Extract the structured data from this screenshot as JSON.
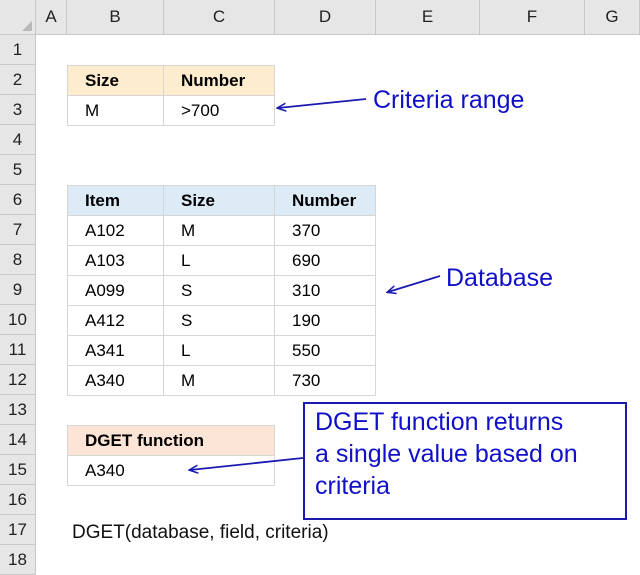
{
  "columns": [
    "A",
    "B",
    "C",
    "D",
    "E",
    "F",
    "G"
  ],
  "rows": [
    "1",
    "2",
    "3",
    "4",
    "5",
    "6",
    "7",
    "8",
    "9",
    "10",
    "11",
    "12",
    "13",
    "14",
    "15",
    "16",
    "17",
    "18"
  ],
  "criteria": {
    "headers": [
      "Size",
      "Number"
    ],
    "values": [
      "M",
      ">700"
    ],
    "label": "Criteria range"
  },
  "database": {
    "headers": [
      "Item",
      "Size",
      "Number"
    ],
    "rows": [
      [
        "A102",
        "M",
        "370"
      ],
      [
        "A103",
        "L",
        "690"
      ],
      [
        "A099",
        "S",
        "310"
      ],
      [
        "A412",
        "S",
        "190"
      ],
      [
        "A341",
        "L",
        "550"
      ],
      [
        "A340",
        "M",
        "730"
      ]
    ],
    "label": "Database"
  },
  "dget": {
    "header": "DGET function",
    "result": "A340",
    "callout": [
      "DGET function returns",
      "a single value based on",
      "criteria"
    ]
  },
  "syntax": "DGET(database, field, criteria)",
  "colors": {
    "criteria_header": "#fdedce",
    "database_header": "#ddebf7",
    "dget_header": "#fce4d6",
    "annotation": "#1010c8"
  }
}
